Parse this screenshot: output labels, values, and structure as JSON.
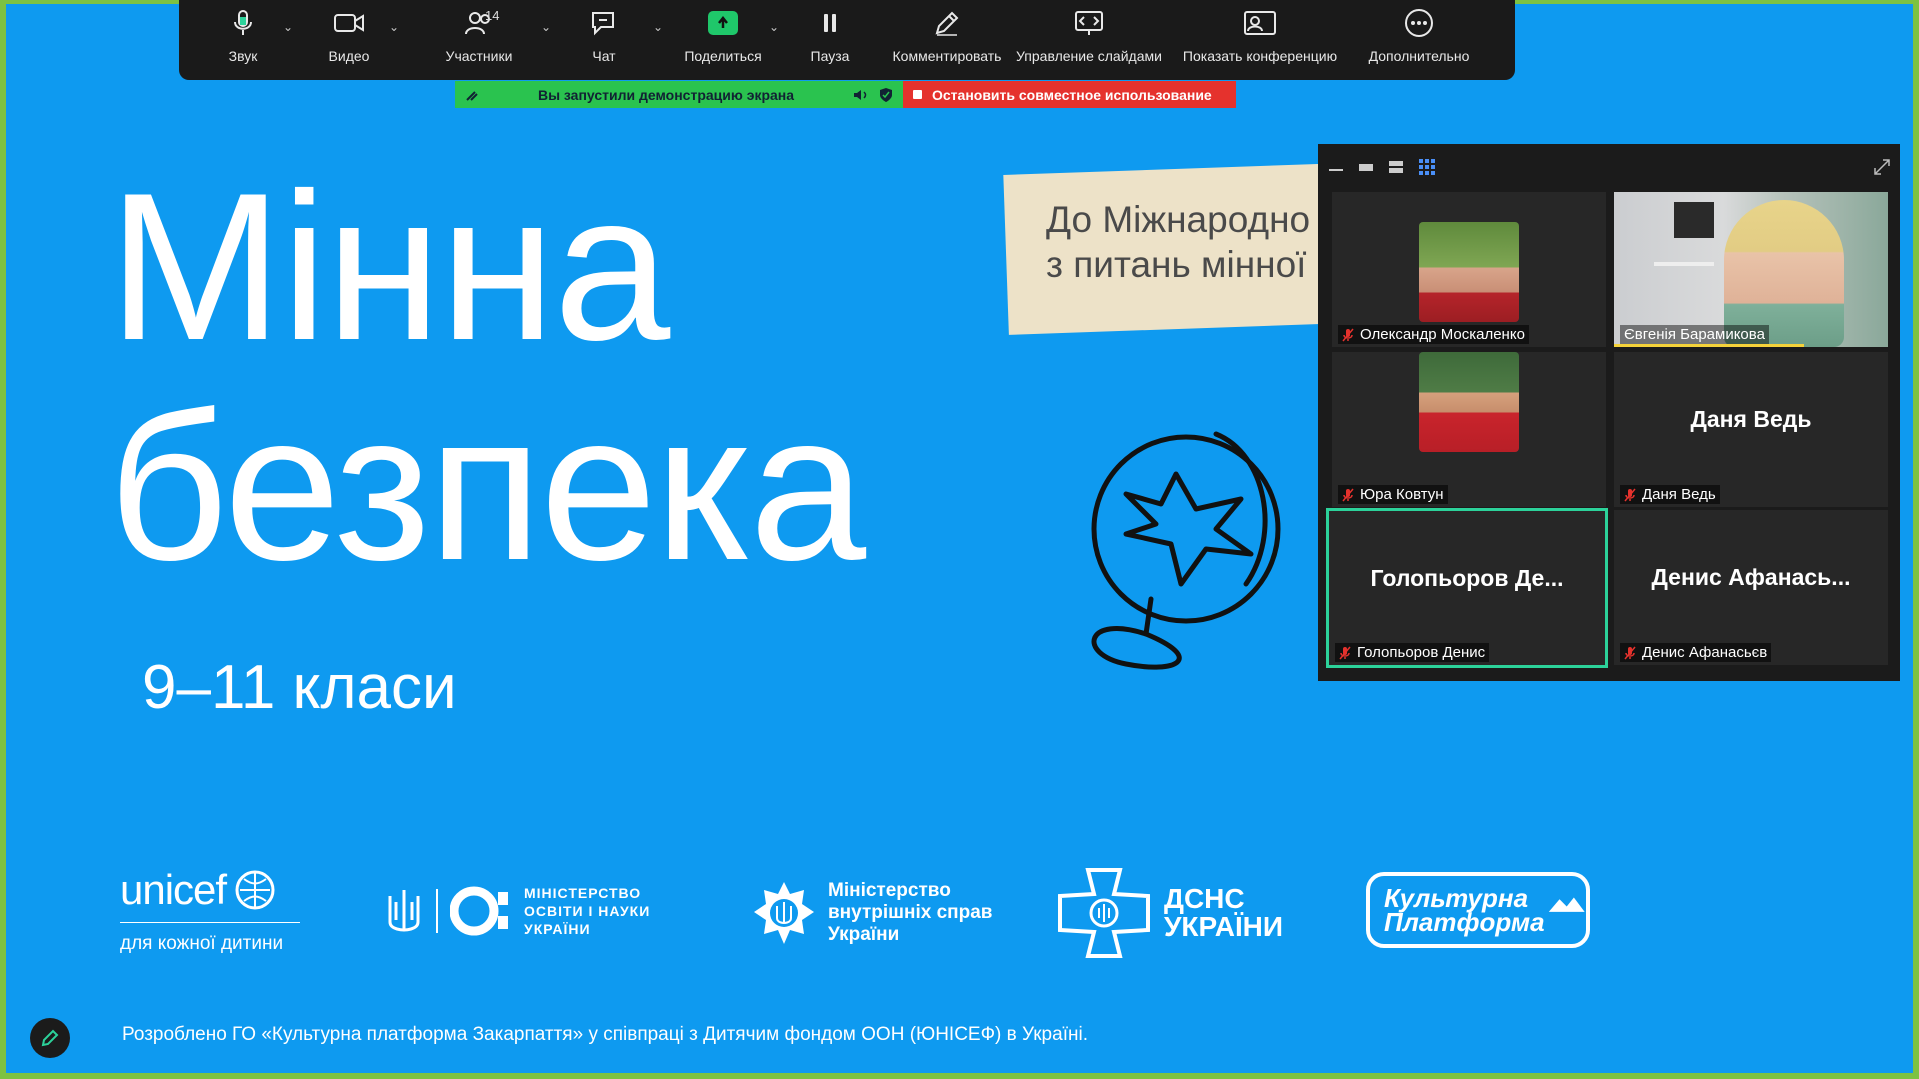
{
  "toolbar": {
    "items": [
      {
        "label": "Звук",
        "icon": "microphone-icon"
      },
      {
        "label": "Видео",
        "icon": "video-camera-icon"
      },
      {
        "label": "Участники",
        "icon": "participants-icon",
        "badge": "14"
      },
      {
        "label": "Чат",
        "icon": "chat-icon"
      },
      {
        "label": "Поделиться",
        "icon": "share-screen-icon"
      },
      {
        "label": "Пауза",
        "icon": "pause-icon"
      },
      {
        "label": "Комментировать",
        "icon": "annotate-pen-icon"
      },
      {
        "label": "Управление слайдами",
        "icon": "slide-control-icon"
      },
      {
        "label": "Показать конференцию",
        "icon": "show-meeting-icon"
      },
      {
        "label": "Дополнительно",
        "icon": "more-icon"
      }
    ]
  },
  "share_banner": {
    "status": "Вы запустили демонстрацию экрана",
    "stop": "Остановить совместное использование"
  },
  "slide": {
    "title_line1": "Мінна",
    "title_line2": "безпека",
    "grades": "9–11 класи",
    "note_line1": "До Міжнародно",
    "note_line2": "з питань мінної",
    "footer": "Розроблено ГО «Культурна платформа Закарпаття» у співпраці з Дитячим фондом ООН (ЮНІСЕФ) в Україні."
  },
  "logos": {
    "unicef_word": "unicef",
    "unicef_sub": "для кожної дитини",
    "mon_line1": "МІНІСТЕРСТВО",
    "mon_line2": "ОСВІТИ І НАУКИ",
    "mon_line3": "УКРАЇНИ",
    "mvs_line1": "Міністерство",
    "mvs_line2": "внутрішніх справ",
    "mvs_line3": "України",
    "dsns_line1": "ДСНС",
    "dsns_line2": "УКРАЇНИ",
    "kp_line1": "Культурна",
    "kp_line2": "Платформа"
  },
  "participants": [
    {
      "name": "Олександр Москаленко",
      "type": "video-avatar"
    },
    {
      "name": "Євгенія Барамикова",
      "type": "video-live"
    },
    {
      "name": "Юра Ковтун",
      "type": "video-avatar"
    },
    {
      "name": "Даня Ведь",
      "center": "Даня Ведь",
      "type": "name"
    },
    {
      "name": "Голопьоров Денис",
      "center": "Голопьоров Де...",
      "type": "name",
      "active": true
    },
    {
      "name": "Денис Афанасьєв",
      "center": "Денис  Афанась...",
      "type": "name"
    }
  ],
  "colors": {
    "slide_bg": "#0e9af0",
    "frame": "#7dc242",
    "active_speaker": "#2cd29a",
    "share_green": "#2ac34f",
    "stop_red": "#e5322d"
  }
}
